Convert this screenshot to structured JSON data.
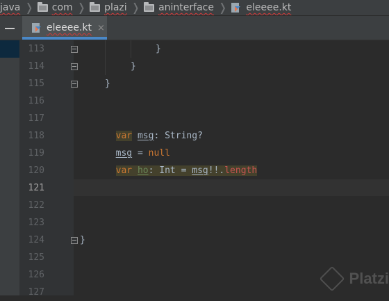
{
  "breadcrumbs": [
    {
      "label": "java",
      "icon": "none"
    },
    {
      "label": "com",
      "icon": "folder-icon"
    },
    {
      "label": "plazi",
      "icon": "folder-icon"
    },
    {
      "label": "aninterface",
      "icon": "folder-icon"
    },
    {
      "label": "eleeee.kt",
      "icon": "kotlin-file-icon"
    }
  ],
  "tab": {
    "label": "eleeee.kt",
    "close": "×"
  },
  "editor": {
    "current_line": "121",
    "lines": [
      {
        "num": "113",
        "code": "}"
      },
      {
        "num": "114",
        "code": "}"
      },
      {
        "num": "115",
        "code": "}"
      },
      {
        "num": "116",
        "code": ""
      },
      {
        "num": "117",
        "kw": "var",
        "name": "msg",
        "rest": ": String?"
      },
      {
        "num": "118",
        "name": "msg",
        "eq": " = ",
        "null": "null"
      },
      {
        "num": "119",
        "kw": "var",
        "name": "ho",
        "type": ": Int = ",
        "ref": "msg",
        "bang": "!!.",
        "prop": "length"
      },
      {
        "num": "120",
        "code": ""
      },
      {
        "num": "121",
        "code": ""
      },
      {
        "num": "122",
        "code": ""
      },
      {
        "num": "123",
        "code": ""
      },
      {
        "num": "124",
        "code": "}"
      },
      {
        "num": "125",
        "code": ""
      },
      {
        "num": "126",
        "code": ""
      },
      {
        "num": "127",
        "code": ""
      }
    ]
  },
  "watermark": {
    "text": "Platzi"
  },
  "colors": {
    "keyword": "#cc7832",
    "text": "#a9b7c6",
    "property": "#c75450",
    "accent": "#4a88c7"
  }
}
